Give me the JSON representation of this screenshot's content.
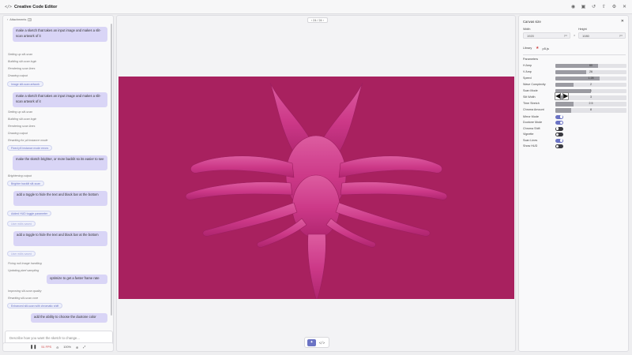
{
  "titlebar": {
    "app_icon": "</>",
    "title": "Creative Code Editor"
  },
  "chat": {
    "attachments_label": "Attachments",
    "attachments_count": "0",
    "entries": [
      {
        "kind": "user",
        "text": "make a sketch that takes an input image and makes a slit-scan artwork of it"
      },
      {
        "kind": "status",
        "text": "Setting up slit-scan"
      },
      {
        "kind": "status",
        "text": "Building slit-scan logic"
      },
      {
        "kind": "status",
        "text": "Rendering scan lines"
      },
      {
        "kind": "status",
        "text": "Drawing output"
      },
      {
        "kind": "badge",
        "text": "Image slit-scan artwork"
      },
      {
        "kind": "user",
        "text": "make a sketch that takes an input image and makes a slit-scan artwork of it"
      },
      {
        "kind": "status",
        "text": "Setting up slit-scan"
      },
      {
        "kind": "status",
        "text": "Building slit-scan logic"
      },
      {
        "kind": "status",
        "text": "Rendering scan lines"
      },
      {
        "kind": "status",
        "text": "Drawing output"
      },
      {
        "kind": "status",
        "text": "Rewriting for pil instance mode"
      },
      {
        "kind": "badge",
        "text": "Fixed p5 instance mode errors"
      },
      {
        "kind": "user",
        "text": "make the sketch brighter, or more backlit so its easier to see"
      },
      {
        "kind": "status",
        "text": "Brightening output"
      },
      {
        "kind": "badge",
        "text": "Brighter backlit slit-scan"
      },
      {
        "kind": "user",
        "text": "add a toggle to hide the text and black bar at the bottom"
      },
      {
        "kind": "badge",
        "text": "Added HUD toggle parameter"
      },
      {
        "kind": "badge",
        "text": "User edits saved",
        "faded": true
      },
      {
        "kind": "user",
        "text": "add a toggle to hide the text and black bar at the bottom"
      },
      {
        "kind": "badge",
        "text": "User edits saved",
        "faded": true
      },
      {
        "kind": "status",
        "text": "Fixing null image handling"
      },
      {
        "kind": "status",
        "text": "Updating pixel sampling"
      },
      {
        "kind": "user",
        "text": "optimize to get a faster frame rate"
      },
      {
        "kind": "status",
        "text": "Improving slit-scan quality"
      },
      {
        "kind": "status",
        "text": "Rewriting slit-scan core"
      },
      {
        "kind": "badge",
        "text": "Enhanced slit-scan with chromatic shift"
      },
      {
        "kind": "user",
        "text": "add the ability to choose the duotone color"
      }
    ],
    "input_placeholder": "Describe how you want the sketch to change...",
    "model_1": "Opus 4.6",
    "model_2": "Craft"
  },
  "playback": {
    "fps": "51 FPS",
    "zoom": "100%"
  },
  "stage": {
    "frame_counter": "24 / 24",
    "bg_color": "#a8215f",
    "figure_color": "#d43c8c"
  },
  "settings": {
    "title": "Canvas size",
    "width_label": "Width",
    "width_value": "1920",
    "height_label": "Height",
    "height_value": "1080",
    "unit": "px",
    "times": "×",
    "library_label": "Library",
    "library_item": "p5.js",
    "parameters_label": "Parameters",
    "sliders": [
      {
        "label": "H Amp",
        "value": "60",
        "fill": 0.6
      },
      {
        "label": "V Amp",
        "value": "26",
        "fill": 0.43
      },
      {
        "label": "Speed",
        "value": "1.28",
        "fill": 0.62
      },
      {
        "label": "Wave Complexity",
        "value": "2",
        "fill": 0.25
      },
      {
        "label": "Scan Mode",
        "value": "1",
        "fill": 0.5
      },
      {
        "label": "Slit Width",
        "value": "3",
        "fill": 0.15
      },
      {
        "label": "Time Stretch",
        "value": "2.5",
        "fill": 0.25
      },
      {
        "label": "Chroma Amount",
        "value": "8",
        "fill": 0.22
      }
    ],
    "toggles": [
      {
        "label": "Mirror Mode",
        "on": true
      },
      {
        "label": "Duotone Mode",
        "on": true
      },
      {
        "label": "Chroma Shift",
        "on": false
      },
      {
        "label": "Vignette",
        "on": false
      },
      {
        "label": "Scan Lines",
        "on": true
      },
      {
        "label": "Show HUD",
        "on": false
      }
    ]
  }
}
